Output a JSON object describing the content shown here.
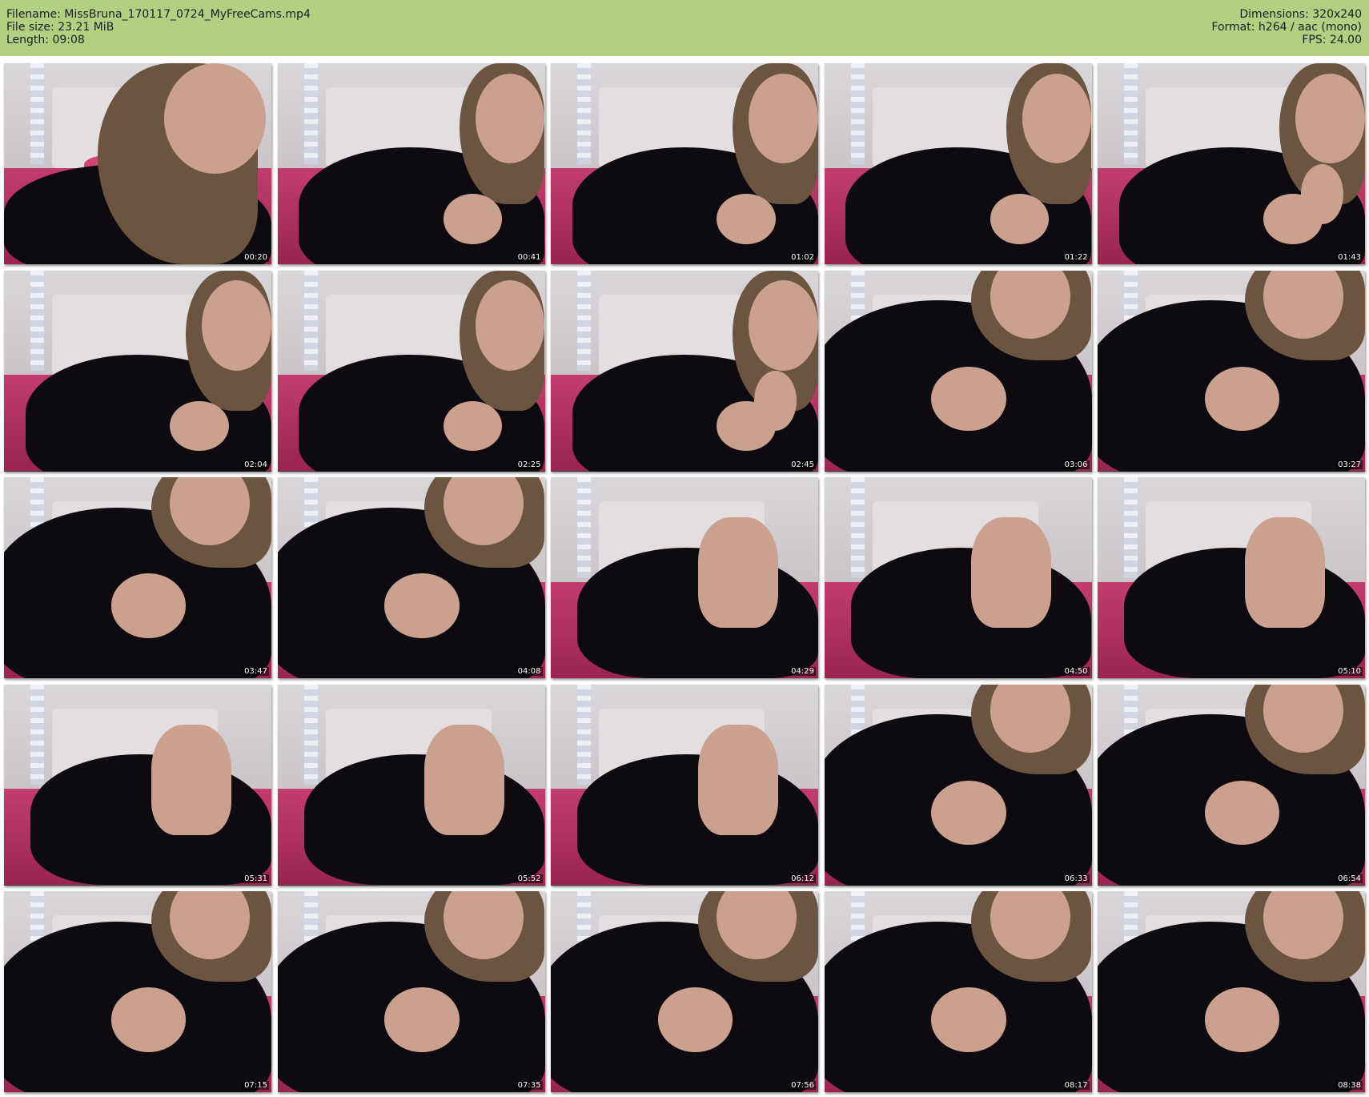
{
  "header": {
    "left": [
      "Filename: MissBruna_170117_0724_MyFreeCams.mp4",
      "File size: 23.21 MiB",
      "Length: 09:08"
    ],
    "right": [
      "Dimensions: 320x240",
      "Format: h264 / aac (mono)",
      "FPS: 24.00"
    ]
  },
  "colors": {
    "header_bg": "#b3cf82",
    "page_bg": "#ffffff"
  },
  "thumbnails": [
    {
      "timestamp": "00:20",
      "scene": "closeup-face"
    },
    {
      "timestamp": "00:41",
      "scene": "lying-face"
    },
    {
      "timestamp": "01:02",
      "scene": "lying-face"
    },
    {
      "timestamp": "01:22",
      "scene": "lying-face"
    },
    {
      "timestamp": "01:43",
      "scene": "lying-hand"
    },
    {
      "timestamp": "02:04",
      "scene": "lying-face"
    },
    {
      "timestamp": "02:25",
      "scene": "lying-face"
    },
    {
      "timestamp": "02:45",
      "scene": "lying-hand"
    },
    {
      "timestamp": "03:06",
      "scene": "closeup-chest"
    },
    {
      "timestamp": "03:27",
      "scene": "closeup-chest"
    },
    {
      "timestamp": "03:47",
      "scene": "closeup-chest"
    },
    {
      "timestamp": "04:08",
      "scene": "closeup-chest"
    },
    {
      "timestamp": "04:29",
      "scene": "arm-watch"
    },
    {
      "timestamp": "04:50",
      "scene": "arm-watch"
    },
    {
      "timestamp": "05:10",
      "scene": "arm-watch"
    },
    {
      "timestamp": "05:31",
      "scene": "arm-watch"
    },
    {
      "timestamp": "05:52",
      "scene": "arm-watch"
    },
    {
      "timestamp": "06:12",
      "scene": "arm-watch"
    },
    {
      "timestamp": "06:33",
      "scene": "closeup-chest"
    },
    {
      "timestamp": "06:54",
      "scene": "closeup-chest"
    },
    {
      "timestamp": "07:15",
      "scene": "closeup-chest"
    },
    {
      "timestamp": "07:35",
      "scene": "closeup-chest"
    },
    {
      "timestamp": "07:56",
      "scene": "closeup-chest"
    },
    {
      "timestamp": "08:17",
      "scene": "closeup-chest"
    },
    {
      "timestamp": "08:38",
      "scene": "closeup-chest"
    }
  ]
}
